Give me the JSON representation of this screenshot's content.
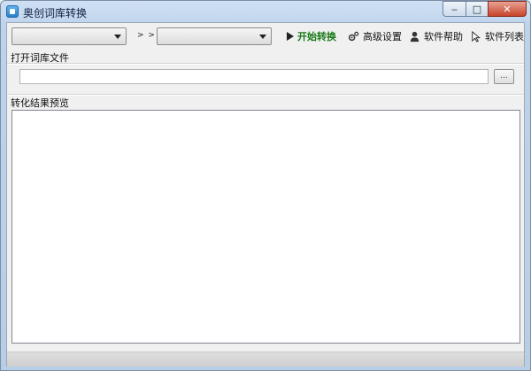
{
  "window": {
    "title": "奥创词库转换",
    "icon": "app-icon",
    "controls": {
      "minimize": "‒",
      "maximize": "□",
      "close": "✕"
    }
  },
  "toolbar": {
    "source_format": {
      "selected": ""
    },
    "arrows_label": "> >",
    "target_format": {
      "selected": ""
    },
    "start_label": "开始转换",
    "advanced_label": "高级设置",
    "help_label": "软件帮助",
    "list_label": "软件列表"
  },
  "open_file": {
    "label": "打开词库文件",
    "path_value": "",
    "browse_label": "..."
  },
  "preview": {
    "label": "转化结果预览",
    "content": ""
  },
  "statusbar": {
    "text": ""
  },
  "colors": {
    "start_text": "#1a7a1a",
    "title_bar": "#bdd3ec"
  }
}
